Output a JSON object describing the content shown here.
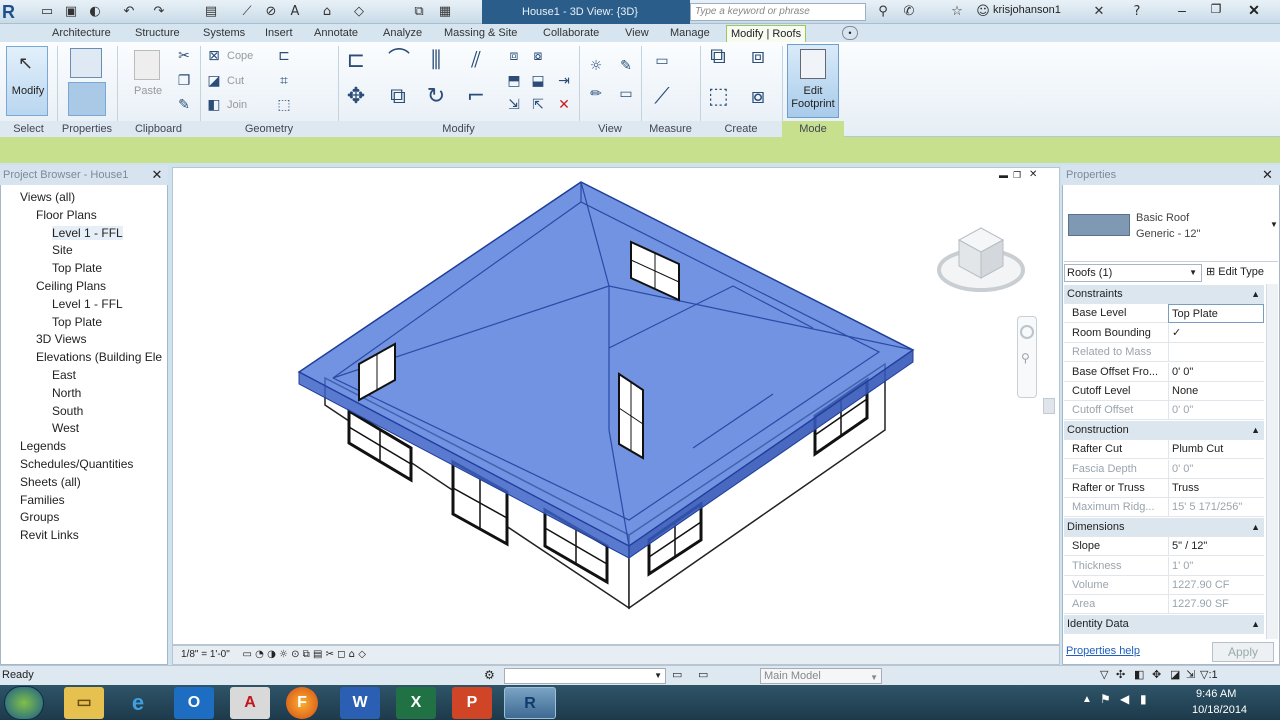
{
  "title_bar": {
    "app_title": "House1 - 3D View: {3D}",
    "search_placeholder": "Type a keyword or phrase",
    "user_name": "krisjohanson1"
  },
  "ribbon_tabs": [
    "Architecture",
    "Structure",
    "Systems",
    "Insert",
    "Annotate",
    "Analyze",
    "Massing & Site",
    "Collaborate",
    "View",
    "Manage",
    "Modify | Roofs"
  ],
  "ribbon": {
    "modify_label": "Modify",
    "paste_label": "Paste",
    "cope_label": "Cope",
    "cut_label": "Cut",
    "join_label": "Join",
    "edit_footprint_label": "Edit Footprint",
    "panels": [
      "Select",
      "Properties",
      "Clipboard",
      "Geometry",
      "Modify",
      "View",
      "Measure",
      "Create",
      "Mode"
    ]
  },
  "project_browser": {
    "title": "Project Browser - House1",
    "items": [
      {
        "label": "Views (all)",
        "level": 0
      },
      {
        "label": "Floor Plans",
        "level": 1
      },
      {
        "label": "Level 1 - FFL",
        "level": 2,
        "selected": true
      },
      {
        "label": "Site",
        "level": 2
      },
      {
        "label": "Top Plate",
        "level": 2
      },
      {
        "label": "Ceiling Plans",
        "level": 1
      },
      {
        "label": "Level 1 - FFL",
        "level": 2
      },
      {
        "label": "Top Plate",
        "level": 2
      },
      {
        "label": "3D Views",
        "level": 1
      },
      {
        "label": "Elevations (Building Ele",
        "level": 1
      },
      {
        "label": "East",
        "level": 2
      },
      {
        "label": "North",
        "level": 2
      },
      {
        "label": "South",
        "level": 2
      },
      {
        "label": "West",
        "level": 2
      },
      {
        "label": "Legends",
        "level": 0
      },
      {
        "label": "Schedules/Quantities",
        "level": 0
      },
      {
        "label": "Sheets (all)",
        "level": 0
      },
      {
        "label": "Families",
        "level": 0
      },
      {
        "label": "Groups",
        "level": 0
      },
      {
        "label": "Revit Links",
        "level": 0
      }
    ]
  },
  "view_bar": {
    "scale": "1/8\" = 1'-0\""
  },
  "properties": {
    "title": "Properties",
    "type_name_1": "Basic Roof",
    "type_name_2": "Generic - 12\"",
    "filter": "Roofs (1)",
    "edit_type": "Edit Type",
    "rows": [
      {
        "cat": "Constraints"
      },
      {
        "k": "Base Level",
        "v": "Top Plate"
      },
      {
        "k": "Room Bounding",
        "v": "✓"
      },
      {
        "k": "Related to Mass",
        "v": "",
        "gray": true
      },
      {
        "k": "Base Offset Fro...",
        "v": "0'  0\""
      },
      {
        "k": "Cutoff Level",
        "v": "None"
      },
      {
        "k": "Cutoff Offset",
        "v": "0'  0\"",
        "gray": true
      },
      {
        "cat": "Construction"
      },
      {
        "k": "Rafter Cut",
        "v": "Plumb Cut"
      },
      {
        "k": "Fascia Depth",
        "v": "0'  0\"",
        "gray": true
      },
      {
        "k": "Rafter or Truss",
        "v": "Truss"
      },
      {
        "k": "Maximum Ridg...",
        "v": "15'  5 171/256\"",
        "gray": true
      },
      {
        "cat": "Dimensions"
      },
      {
        "k": "Slope",
        "v": "5\" / 12\""
      },
      {
        "k": "Thickness",
        "v": "1'  0\"",
        "gray": true
      },
      {
        "k": "Volume",
        "v": "1227.90 CF",
        "gray": true
      },
      {
        "k": "Area",
        "v": "1227.90 SF",
        "gray": true
      },
      {
        "cat": "Identity Data"
      }
    ],
    "help_link": "Properties help",
    "apply_label": "Apply"
  },
  "status_bar": {
    "status": "Ready",
    "model": "Main Model"
  },
  "taskbar": {
    "time": "9:46 AM",
    "date": "10/18/2014"
  }
}
